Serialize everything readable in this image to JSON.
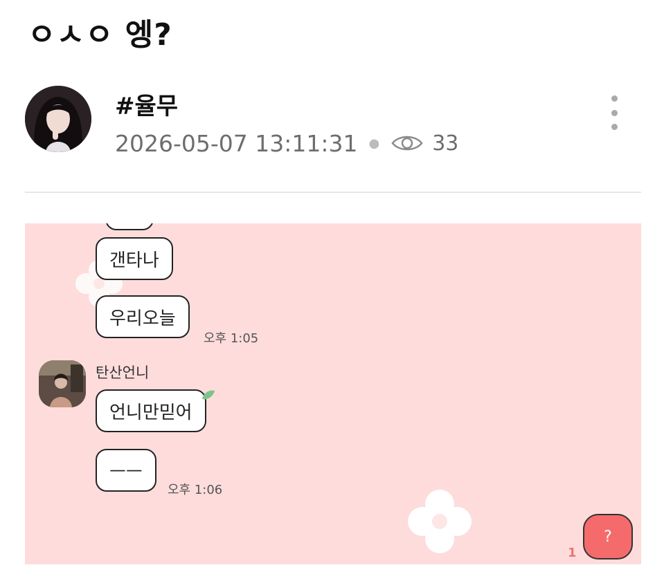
{
  "post": {
    "title": "ㅇㅅㅇ 엥?",
    "author": "#율무",
    "datetime": "2026-05-07 13:11:31",
    "views": "33"
  },
  "chat": {
    "messages_top": [
      {
        "text": "갠타나"
      },
      {
        "text": "우리오늘",
        "time": "오후 1:05"
      }
    ],
    "sender_name": "탄산언니",
    "messages_sender": [
      {
        "text": "언니만믿어"
      },
      {
        "text": "ㅡㅡ",
        "time": "오후 1:06"
      }
    ],
    "my_message": "?",
    "unread_count": "1"
  },
  "colors": {
    "chat_background": "#fedcdc",
    "my_bubble": "#f56b6b",
    "unread": "#f07373",
    "leaf": "#7bc58a"
  }
}
